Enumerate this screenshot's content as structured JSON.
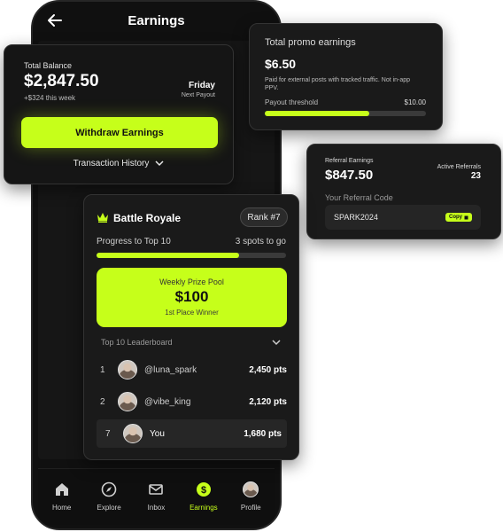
{
  "app": {
    "screen_title": "Earnings",
    "accent_color": "#c6ff1a"
  },
  "balance": {
    "label": "Total Balance",
    "amount": "$2,847.50",
    "weekly_change": "+$324 this week",
    "payout_day": "Friday",
    "payout_label": "Next Payout",
    "withdraw_label": "Withdraw Earnings",
    "history_label": "Transaction History"
  },
  "promo": {
    "title": "Total promo earnings",
    "amount": "$6.50",
    "description": "Paid for external posts with tracked traffic. Not in-app PPV.",
    "threshold_label": "Payout threshold",
    "threshold_value": "$10.00",
    "progress_fraction": 0.65
  },
  "referral": {
    "label": "Referral Earnings",
    "amount": "$847.50",
    "active_label": "Active Referrals",
    "active_count": "23",
    "code_label": "Your Referral Code",
    "code": "SPARK2024",
    "copy_label": "Copy"
  },
  "battle": {
    "title": "Battle Royale",
    "rank": "Rank #7",
    "progress_label": "Progress to Top 10",
    "progress_right": "3 spots to go",
    "progress_fraction": 0.75,
    "prize_label": "Weekly Prize Pool",
    "prize_amount": "$100",
    "prize_sub": "1st Place Winner",
    "leaderboard_title": "Top 10 Leaderboard",
    "rows": [
      {
        "rank": "1",
        "name": "@luna_spark",
        "points": "2,450 pts"
      },
      {
        "rank": "2",
        "name": "@vibe_king",
        "points": "2,120 pts"
      },
      {
        "rank": "7",
        "name": "You",
        "points": "1,680 pts"
      }
    ]
  },
  "nav": {
    "items": [
      {
        "label": "Home",
        "icon": "home-icon"
      },
      {
        "label": "Explore",
        "icon": "compass-icon"
      },
      {
        "label": "Inbox",
        "icon": "mail-icon"
      },
      {
        "label": "Earnings",
        "icon": "dollar-icon"
      },
      {
        "label": "Profile",
        "icon": "avatar-icon"
      }
    ],
    "active": "Earnings"
  }
}
